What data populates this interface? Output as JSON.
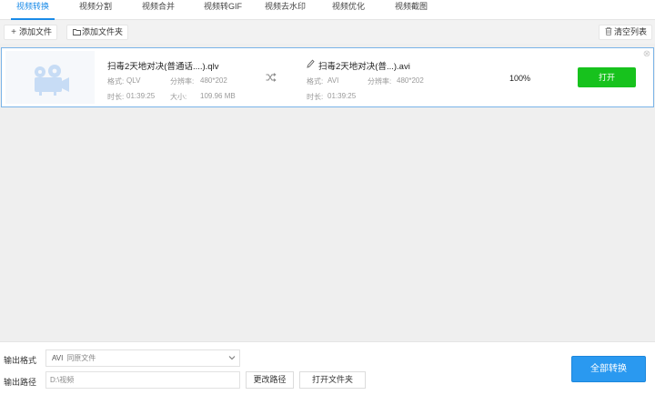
{
  "tabs": [
    {
      "label": "视频转换"
    },
    {
      "label": "视频分割"
    },
    {
      "label": "视频合并"
    },
    {
      "label": "视频转GIF"
    },
    {
      "label": "视频去水印"
    },
    {
      "label": "视频优化"
    },
    {
      "label": "视频截图"
    }
  ],
  "toolbar": {
    "add_file": "添加文件",
    "add_folder": "添加文件夹",
    "clear_list": "清空列表"
  },
  "file": {
    "source": {
      "name": "扫毒2天地对决(普通话....).qlv",
      "format_label": "格式:",
      "format": "QLV",
      "resolution_label": "分辨率:",
      "resolution": "480*202",
      "duration_label": "时长:",
      "duration": "01:39:25",
      "size_label": "大小:",
      "size": "109.96 MB"
    },
    "output": {
      "name": "扫毒2天地对决(普...).avi",
      "format_label": "格式:",
      "format": "AVI",
      "resolution_label": "分辨率:",
      "resolution": "480*202",
      "duration_label": "时长:",
      "duration": "01:39:25"
    },
    "progress_text": "100%",
    "progress": 1.0,
    "open_label": "打开"
  },
  "footer": {
    "format_label": "输出格式",
    "format_value": "AVI",
    "format_sub": "同原文件",
    "path_label": "输出路径",
    "path_value": "D:\\视频",
    "change_path": "更改路径",
    "open_folder": "打开文件夹",
    "convert_all": "全部转换"
  },
  "colors": {
    "accent": "#1a8be8",
    "open_button": "#17c21d",
    "convert_button": "#2a99f0",
    "row_border": "#7ab4e8"
  }
}
